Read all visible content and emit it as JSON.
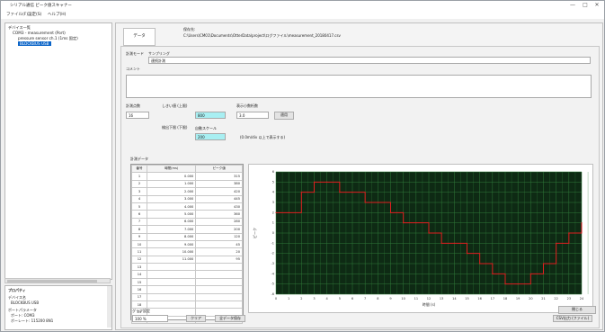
{
  "titlebar": {
    "title": "シリアル通信 ピーク値スキャナー",
    "controls": [
      "—",
      "□",
      "✕"
    ]
  },
  "menu": [
    "ファイル(F)",
    "設定(S)",
    "ヘルプ(H)"
  ],
  "tree": {
    "root": "デバイス一覧",
    "child1": "COM3 - measurement (Port)",
    "child2": "pressure sensor ch.1 (1ms 固定)",
    "selected": "BLOCKBUS USB"
  },
  "props": {
    "title": "プロパティ",
    "l1": "デバイス名",
    "v1": "BLOCKBUS USB",
    "l2": "ポートパラメータ",
    "v2": "ポート: COM3",
    "v3": "ボーレート: 115200 8N1"
  },
  "main": {
    "tab": "データ",
    "path_label": "保存先:",
    "path_value": "C:\\Users\\CM01\\Documents\\OtterData\\project\\ログファイル\\measurement_20180417.csv"
  },
  "form": {
    "mode_label": "計測モード",
    "mode_value": "連続計測",
    "interval_label": "サンプリング",
    "interval_value": "1 ms",
    "comment_label": "コメント",
    "count_label": "計測点数",
    "count_value": "16",
    "thresh_label": "しきい値 (上限)",
    "thresh_value": "800",
    "min_label": "検出下限 (下限)",
    "min_value": "200",
    "dec_label": "表示小数桁数",
    "dec_value": "3.0",
    "apply_button": "適用",
    "auto_label": "自動スケール",
    "auto_value": "0.00",
    "note": "(0.0m/div 以上で表示する)",
    "grid_title": "計測データ"
  },
  "table": {
    "headers": [
      "番号",
      "時間(ms)",
      "ピーク値"
    ],
    "rows": [
      [
        "1",
        "0.000",
        "315"
      ],
      [
        "2",
        "1.000",
        "380"
      ],
      [
        "3",
        "2.000",
        "420"
      ],
      [
        "4",
        "3.000",
        "445"
      ],
      [
        "5",
        "4.000",
        "430"
      ],
      [
        "6",
        "5.000",
        "360"
      ],
      [
        "7",
        "6.000",
        "280"
      ],
      [
        "8",
        "7.000",
        "200"
      ],
      [
        "9",
        "8.000",
        "120"
      ],
      [
        "10",
        "9.000",
        "45"
      ],
      [
        "11",
        "10.000",
        "20"
      ],
      [
        "12",
        "11.000",
        "95"
      ],
      [
        "13",
        "",
        ""
      ],
      [
        "14",
        "",
        ""
      ],
      [
        "15",
        "",
        ""
      ],
      [
        "16",
        "",
        ""
      ],
      [
        "17",
        "",
        ""
      ],
      [
        "18",
        "",
        ""
      ],
      [
        "19",
        "",
        ""
      ],
      [
        "20",
        "",
        ""
      ]
    ]
  },
  "bottom": {
    "group_label": "グラフ設定",
    "zoom_value": "100 %",
    "left_button": "クリア",
    "mid_button": "全データ保存",
    "csv_button": "CSV出力 (ファイル)",
    "close_button": "閉じる"
  },
  "chart_data": {
    "type": "line",
    "title": "",
    "xlabel": "時間 (s)",
    "ylabel": "ピーク",
    "series": [
      {
        "x": [
          0,
          1,
          2,
          3,
          4,
          5,
          6,
          7,
          8,
          9,
          10,
          11,
          12,
          13,
          14,
          15,
          16,
          17,
          18,
          19,
          20,
          21,
          22,
          23,
          24
        ],
        "y": [
          2,
          2,
          4,
          5,
          5,
          4,
          4,
          3,
          3,
          2,
          1,
          1,
          0,
          -1,
          -1,
          -2,
          -3,
          -4,
          -5,
          -5,
          -4,
          -3,
          -1,
          0,
          1
        ],
        "color": "#e02020"
      }
    ],
    "ylim": [
      -6,
      6
    ],
    "xlim": [
      0,
      24
    ],
    "grid": true,
    "background": "#0e2a14",
    "grid_color": "#2f7a39"
  }
}
